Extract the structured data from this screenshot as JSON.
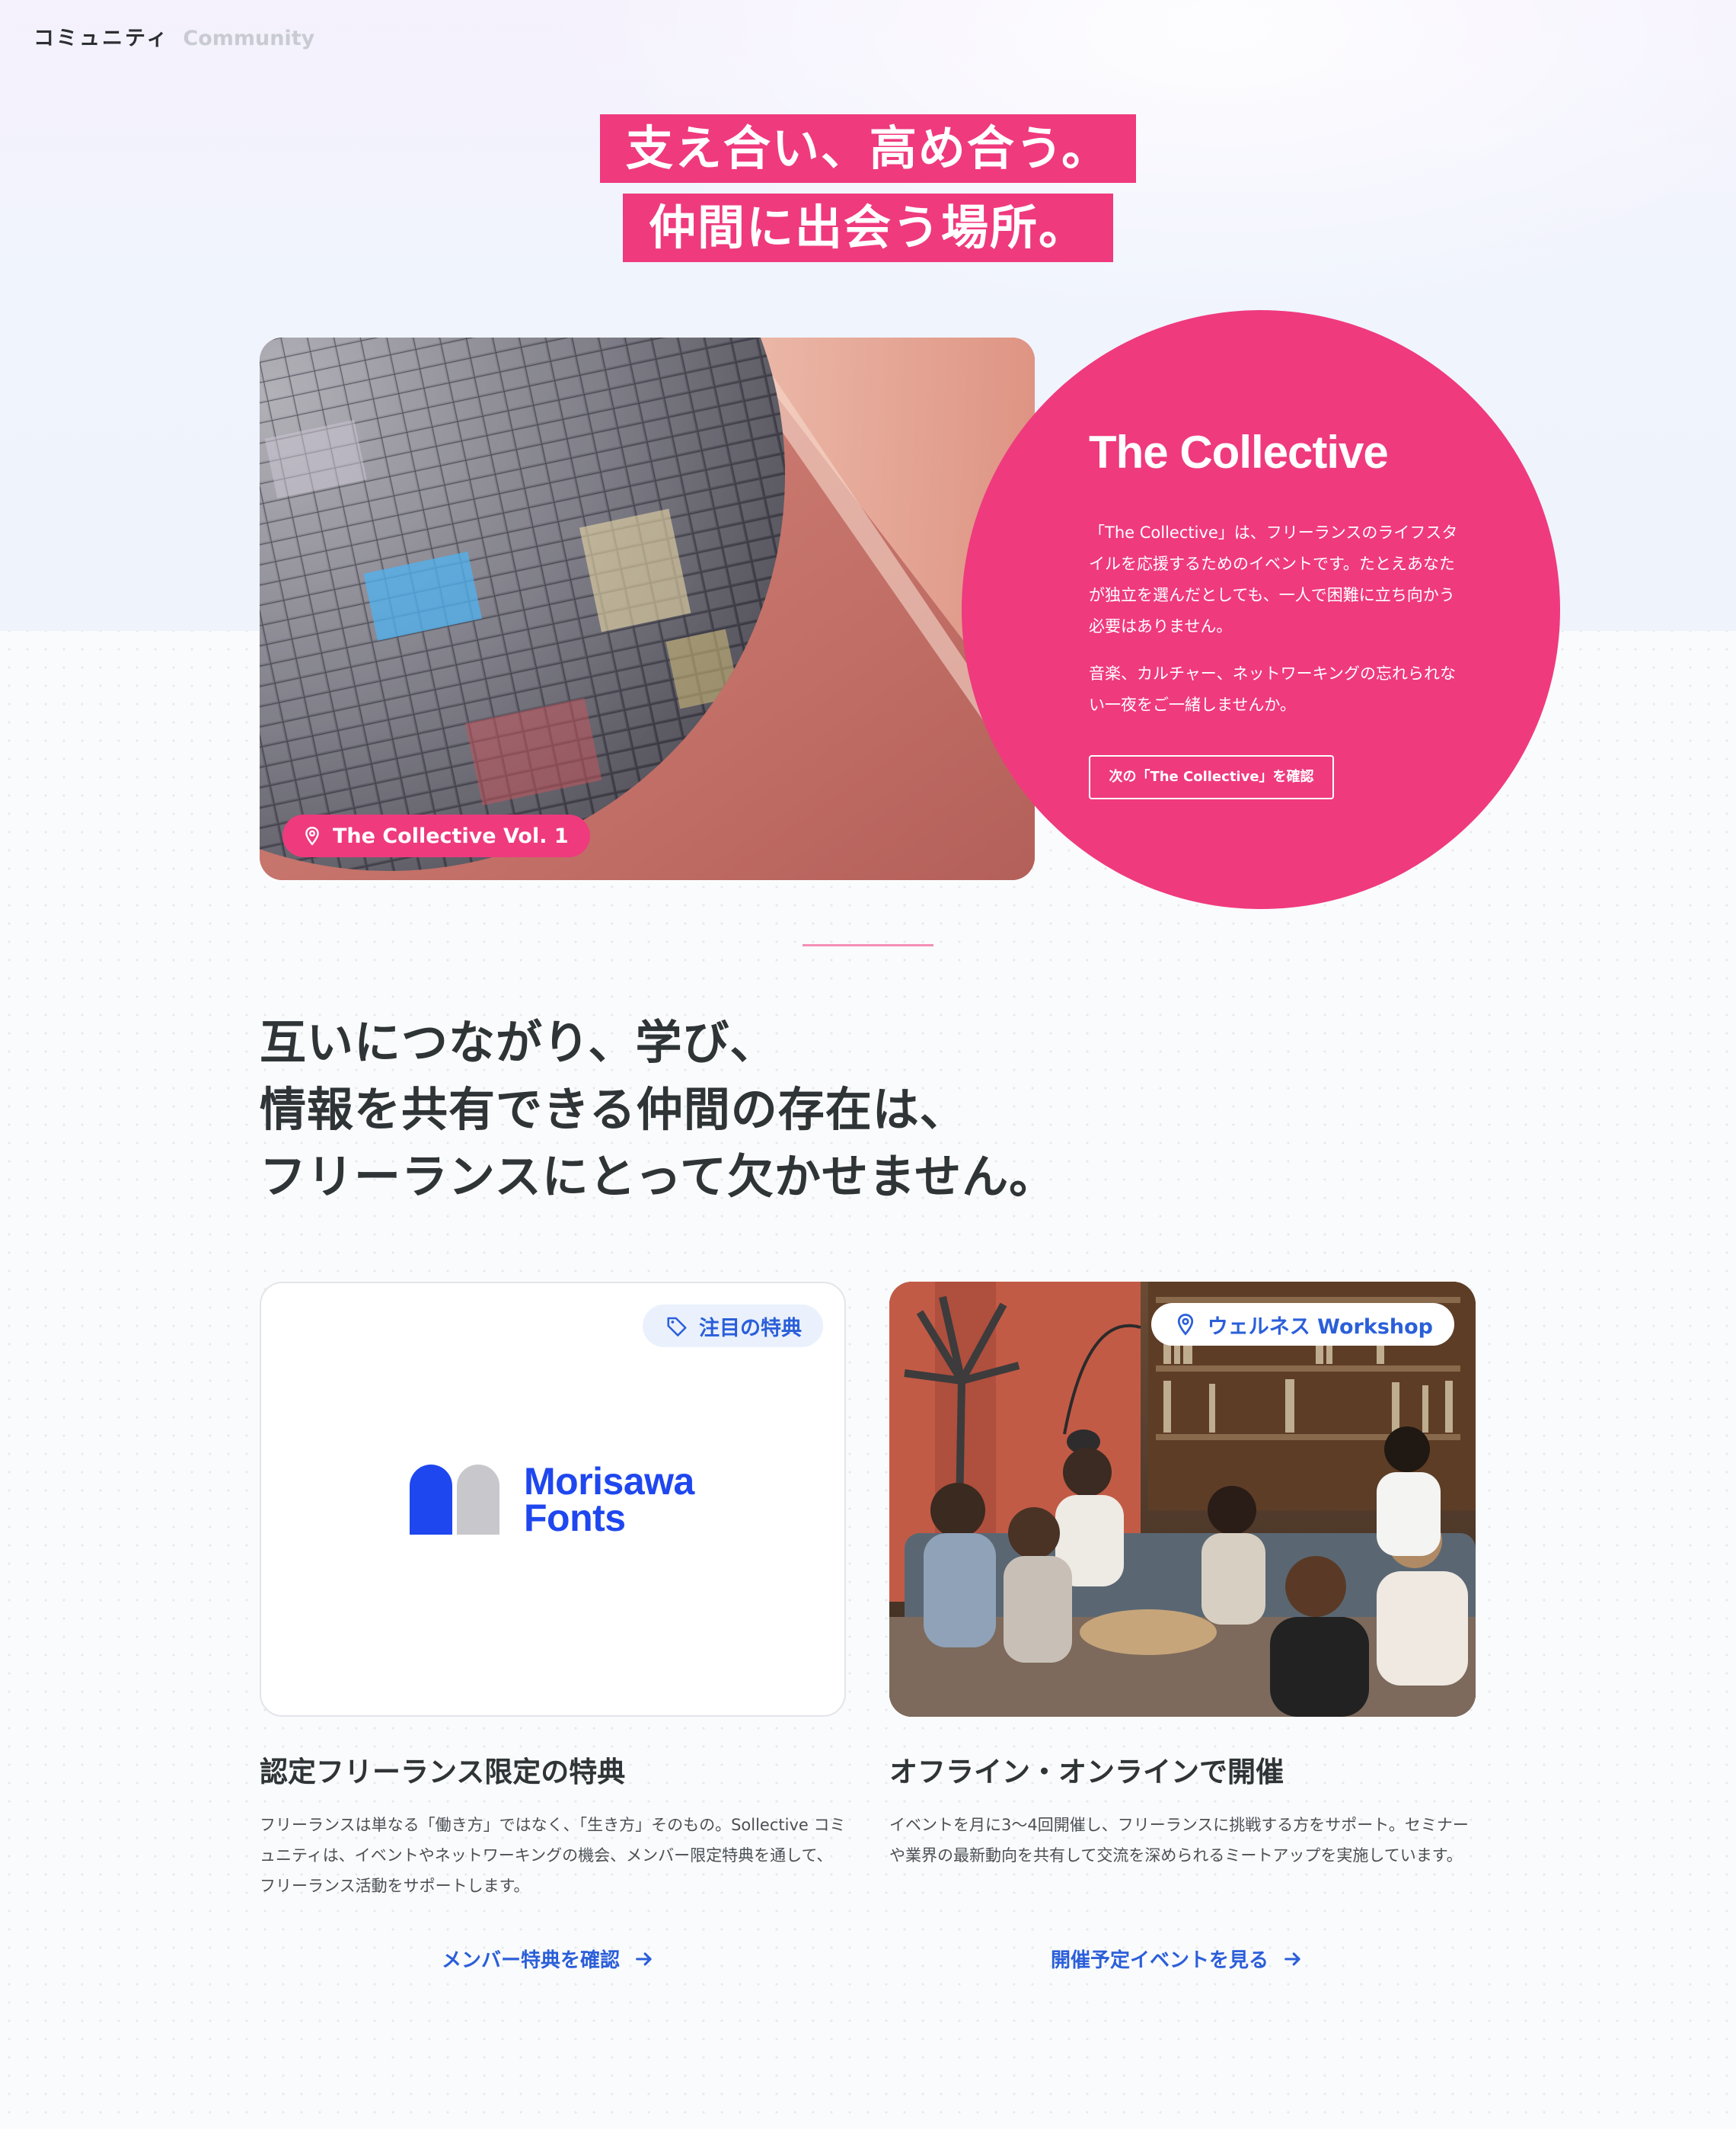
{
  "breadcrumb": {
    "jp": "コミュニティ",
    "en": "Community"
  },
  "hero": {
    "line1": "支え合い、高め合う。",
    "line2": "仲間に出会う場所。"
  },
  "collective": {
    "photo_pill": "The Collective Vol. 1",
    "title": "The Collective",
    "body1": "「The Collective」は、フリーランスのライフスタイルを応援するためのイベントです。たとえあなたが独立を選んだとしても、一人で困難に立ち向かう必要はありません。",
    "body2": "音楽、カルチャー、ネットワーキングの忘れられない一夜をご一緒しませんか。",
    "button": "次の「The Collective」を確認"
  },
  "lead": {
    "line1": "互いにつながり、学び、",
    "line2": "情報を共有できる仲間の存在は、",
    "line3": "フリーランスにとって欠かせません。"
  },
  "cards": [
    {
      "tag": "注目の特典",
      "logo_line1": "Morisawa",
      "logo_line2": "Fonts",
      "heading": "認定フリーランス限定の特典",
      "body": "フリーランスは単なる「働き方」ではなく、「生き方」そのもの。Sollective コミュニティは、イベントやネットワーキングの機会、メンバー限定特典を通して、フリーランス活動をサポートします。",
      "link": "メンバー特典を確認"
    },
    {
      "tag": "ウェルネス Workshop",
      "heading": "オフライン・オンラインで開催",
      "body": "イベントを月に3〜4回開催し、フリーランスに挑戦する方をサポート。セミナーや業界の最新動向を共有して交流を深められるミートアップを実施しています。",
      "link": "開催予定イベントを見る"
    }
  ],
  "colors": {
    "accent_pink": "#ef3a7e",
    "link_blue": "#2b5fd9",
    "logo_blue": "#1f47ef"
  },
  "icons": [
    "location-pin-icon",
    "tag-icon",
    "arrow-right-icon",
    "morisawa-logo-icon"
  ]
}
